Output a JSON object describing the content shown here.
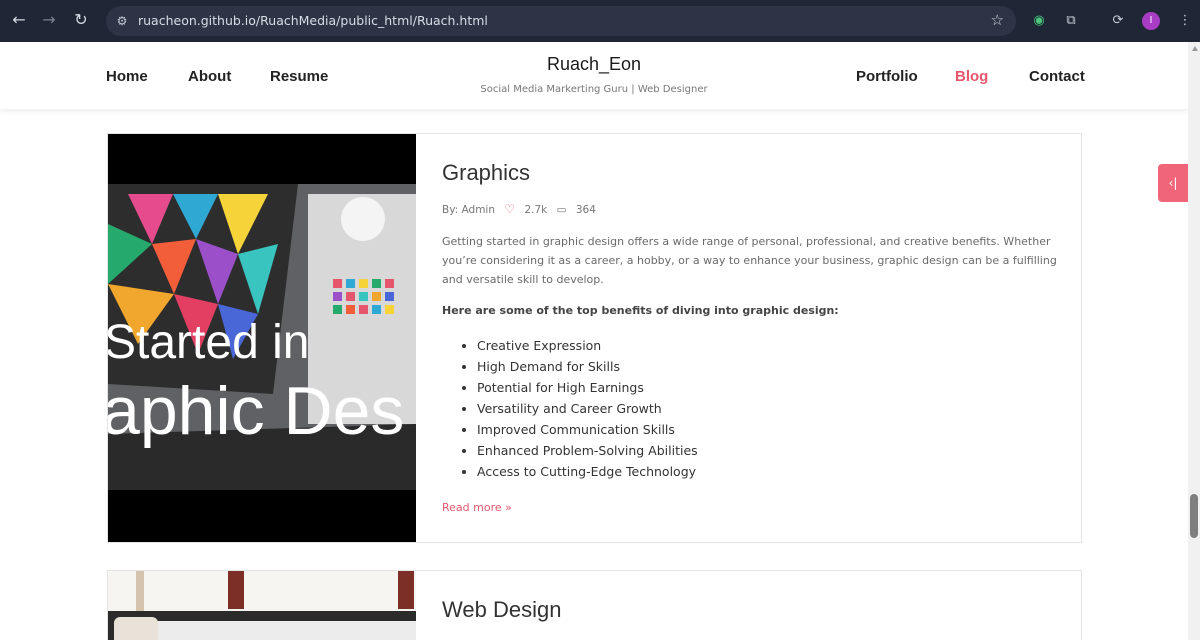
{
  "browser": {
    "url": "ruacheon.github.io/RuachMedia/public_html/Ruach.html",
    "profile_initial": "I"
  },
  "site": {
    "brand": "Ruach_Eon",
    "tagline": "Social Media Markerting Guru | Web Designer",
    "menu_left": [
      "Home",
      "About",
      "Resume"
    ],
    "menu_right": [
      "Portfolio",
      "Blog",
      "Contact"
    ],
    "active_menu": "Blog",
    "accent_color": "#e5566d"
  },
  "posts": [
    {
      "title": "Graphics",
      "meta": {
        "by": "By: Admin",
        "likes": "2.7k",
        "comments": "364"
      },
      "excerpt": "Getting started in graphic design offers a wide range of personal, professional, and creative benefits. Whether you’re considering it as a career, a hobby, or a way to enhance your business, graphic design can be a fulfilling and versatile skill to develop.",
      "benefits_heading": "Here are some of the top benefits of diving into graphic design:",
      "benefits": [
        "Creative Expression",
        "High Demand for Skills",
        "Potential for High Earnings",
        "Versatility and Career Growth",
        "Improved Communication Skills",
        "Enhanced Problem-Solving Abilities",
        "Access to Cutting-Edge Technology"
      ],
      "image_text": [
        "Started in",
        "aphic Des"
      ],
      "read_more": "Read more"
    },
    {
      "title": "Web Design"
    }
  ],
  "side_tab_icon": "‹|"
}
